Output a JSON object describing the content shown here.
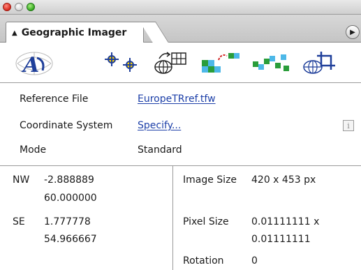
{
  "panel": {
    "tab_label": "Geographic Imager",
    "tab_arrows": "⬍"
  },
  "toolbar": {
    "icons": [
      "geographic-imager-logo",
      "reference-points",
      "georeference",
      "mosaic",
      "transform",
      "tile",
      "crop"
    ]
  },
  "reference_file": {
    "label": "Reference File",
    "value": "EuropeTRref.tfw"
  },
  "coordinate_system": {
    "label": "Coordinate System",
    "value": "Specify...",
    "info_label": "i"
  },
  "mode": {
    "label": "Mode",
    "value": "Standard"
  },
  "corners": {
    "nw_label": "NW",
    "nw_x": "-2.888889",
    "nw_y": "60.000000",
    "se_label": "SE",
    "se_x": "1.777778",
    "se_y": "54.966667"
  },
  "image_info": {
    "size_label": "Image Size",
    "size_value": "420 x 453 px",
    "pixel_label": "Pixel Size",
    "pixel_value_1": "0.01111111 x",
    "pixel_value_2": "0.01111111",
    "rotation_label": "Rotation",
    "rotation_value": "0"
  },
  "colors": {
    "link": "#1c3fa8",
    "close": "#d8271c",
    "zoom": "#32a81c"
  }
}
